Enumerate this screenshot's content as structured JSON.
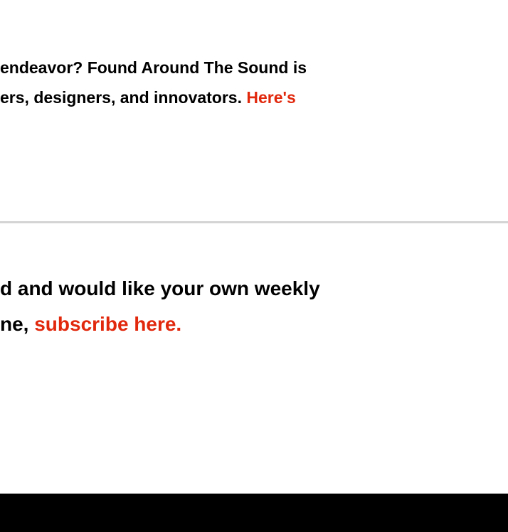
{
  "intro": {
    "line1": "endeavor? Found Around The Sound is",
    "line2_text": "ers, designers, and innovators. ",
    "line2_link": "Here's"
  },
  "subscribe": {
    "line1": "d and would like your own weekly",
    "line2_text": "ne, ",
    "line2_link": "subscribe here."
  },
  "colors": {
    "link": "#e1280d",
    "divider": "#d4d4d4",
    "footer": "#000000"
  }
}
